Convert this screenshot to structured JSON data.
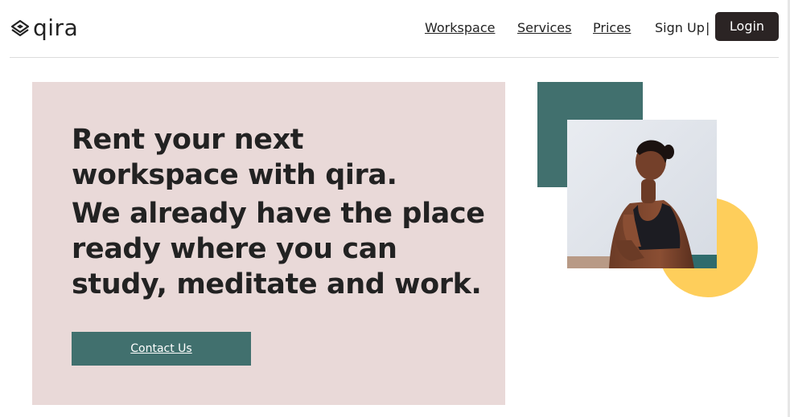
{
  "brand": {
    "name": "qira",
    "logo_icon": "layered-diamond-logo-icon"
  },
  "nav": {
    "workspace": "Workspace",
    "services": "Services",
    "prices": "Prices",
    "sign_up": "Sign Up",
    "separator": "|",
    "login": "Login"
  },
  "hero": {
    "title": "Rent your next workspace with qira.",
    "subtitle": "We already have the place ready where you can study, meditate and work.",
    "cta": "Contact Us"
  },
  "colors": {
    "hero_background": "#e9d9d8",
    "accent_green": "#41706e",
    "accent_yellow": "#fece5b",
    "login_background": "#2b2424"
  }
}
